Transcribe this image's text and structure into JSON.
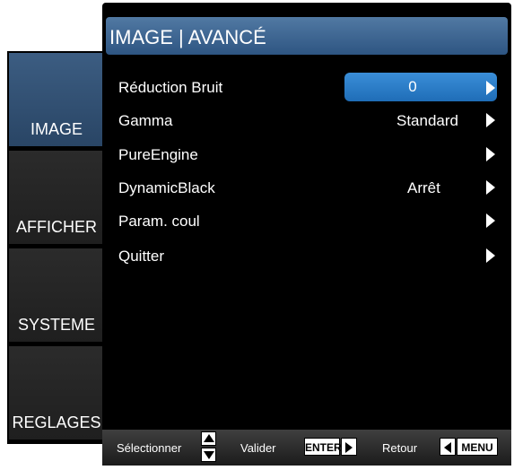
{
  "tabs": [
    {
      "label": "IMAGE",
      "active": true
    },
    {
      "label": "AFFICHER",
      "active": false
    },
    {
      "label": "SYSTEME",
      "active": false
    },
    {
      "label": "REGLAGES",
      "active": false
    }
  ],
  "title": "IMAGE | AVANCÉ",
  "menu": {
    "reduction": {
      "label": "Réduction Bruit",
      "value": "0"
    },
    "gamma": {
      "label": "Gamma",
      "value": "Standard"
    },
    "pureengine": {
      "label": "PureEngine"
    },
    "dynamicblack": {
      "label": "DynamicBlack",
      "value": "Arrêt"
    },
    "param": {
      "label": "Param. coul"
    },
    "quitter": {
      "label": "Quitter"
    }
  },
  "help": {
    "select": "Sélectionner",
    "validate": "Valider",
    "enter_key": "ENTER",
    "back": "Retour",
    "menu_key": "MENU"
  },
  "icons": [
    "arrow-up-icon",
    "arrow-down-icon",
    "arrow-right-icon",
    "arrow-left-icon"
  ],
  "colors": {
    "accent": "#2e5582",
    "highlight": "#1f6db7"
  }
}
